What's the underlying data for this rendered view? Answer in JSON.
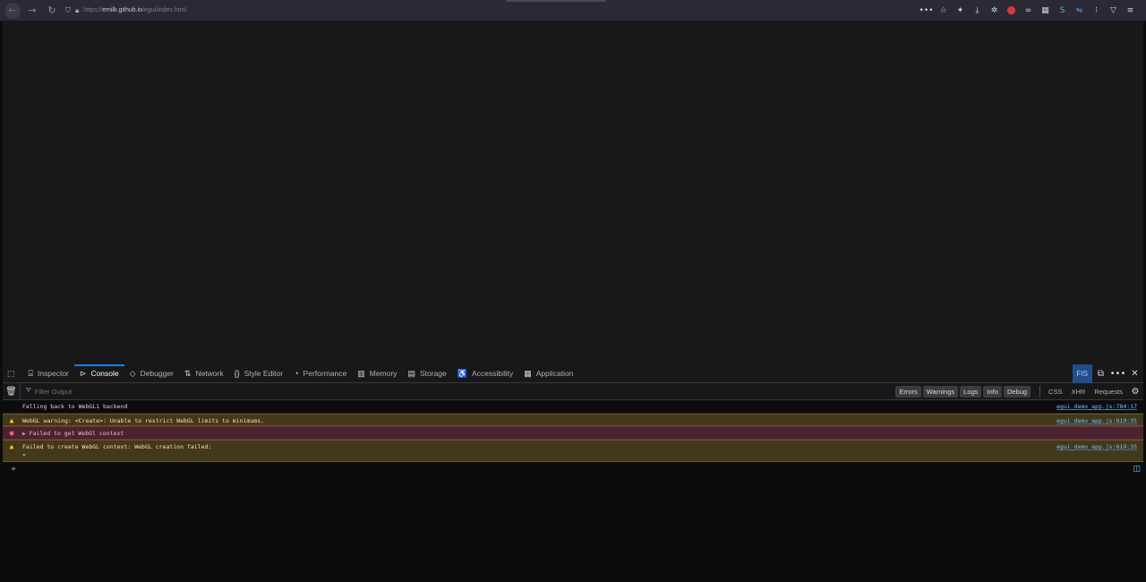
{
  "browser": {
    "url_proto": "https://",
    "url_host": "emilk.github.io",
    "url_path": "/egui/index.html",
    "toolbar_icons": [
      "more-icon",
      "bookmark-star-icon",
      "extensions-icon",
      "download-icon",
      "settings-icon",
      "ublock-icon",
      "link-icon",
      "grid-icon",
      "translate-icon",
      "sync-icon",
      "menu-icon",
      "dropdown-icon",
      "hamburger-icon"
    ]
  },
  "devtools": {
    "tabs": [
      {
        "label": "Inspector",
        "icon": "inspector-icon",
        "glyph": "⌸"
      },
      {
        "label": "Console",
        "icon": "console-icon",
        "glyph": "⊳"
      },
      {
        "label": "Debugger",
        "icon": "debugger-icon",
        "glyph": "◇"
      },
      {
        "label": "Network",
        "icon": "network-icon",
        "glyph": "⇅"
      },
      {
        "label": "Style Editor",
        "icon": "style-editor-icon",
        "glyph": "{}"
      },
      {
        "label": "Performance",
        "icon": "performance-icon",
        "glyph": "◔"
      },
      {
        "label": "Memory",
        "icon": "memory-icon",
        "glyph": "▥"
      },
      {
        "label": "Storage",
        "icon": "storage-icon",
        "glyph": "▤"
      },
      {
        "label": "Accessibility",
        "icon": "accessibility-icon",
        "glyph": "♿"
      },
      {
        "label": "Application",
        "icon": "application-icon",
        "glyph": "▦"
      }
    ],
    "active_tab": "Console",
    "fis_label": "FIS",
    "filter_placeholder": "Filter Output",
    "levels": [
      "Errors",
      "Warnings",
      "Logs",
      "Info",
      "Debug"
    ],
    "types": [
      "CSS",
      "XHR",
      "Requests"
    ],
    "accent_color": "#0a84ff"
  },
  "console": {
    "messages": [
      {
        "level": "log",
        "text": "Falling back to WebGL1 backend",
        "source": "egui_demo_app.js:784:17"
      },
      {
        "level": "warning",
        "text": "WebGL warning: <Create>: Unable to restrict WebGL limits to minimums.",
        "source": "egui_demo_app.js:819:35"
      },
      {
        "level": "error",
        "text": "Failed to get WebGl context",
        "source": ""
      },
      {
        "level": "warning",
        "text": "Failed to create WebGL context: WebGL creation failed:",
        "extra": "*",
        "source": "egui_demo_app.js:819:35"
      }
    ]
  }
}
